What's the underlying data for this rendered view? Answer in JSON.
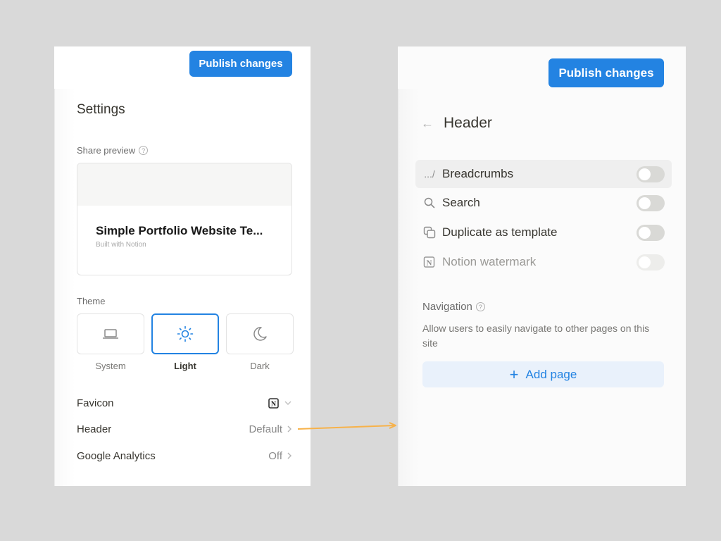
{
  "left_panel": {
    "publish_label": "Publish changes",
    "title": "Settings",
    "share_preview": {
      "label": "Share preview",
      "help_icon": "?",
      "card_title": "Simple Portfolio Website Te...",
      "card_subtitle": "Built with Notion"
    },
    "theme": {
      "label": "Theme",
      "options": [
        {
          "name": "System",
          "icon": "laptop-icon",
          "selected": false
        },
        {
          "name": "Light",
          "icon": "sun-icon",
          "selected": true
        },
        {
          "name": "Dark",
          "icon": "moon-icon",
          "selected": false
        }
      ]
    },
    "rows": [
      {
        "label": "Favicon",
        "value": "",
        "icon": "notion-logo-icon",
        "chevron": "chevron-down-icon"
      },
      {
        "label": "Header",
        "value": "Default",
        "chevron": "chevron-right-icon"
      },
      {
        "label": "Google Analytics",
        "value": "Off",
        "chevron": "chevron-right-icon"
      }
    ]
  },
  "right_panel": {
    "publish_label": "Publish changes",
    "back_icon": "←",
    "title": "Header",
    "toggles": [
      {
        "label": "Breadcrumbs",
        "icon_text": ".../",
        "enabled": false,
        "disabled": false,
        "hovered": true
      },
      {
        "label": "Search",
        "icon_text": "",
        "enabled": false,
        "disabled": false,
        "hovered": false
      },
      {
        "label": "Duplicate as template",
        "icon_text": "",
        "enabled": false,
        "disabled": false,
        "hovered": false
      },
      {
        "label": "Notion watermark",
        "icon_text": "N",
        "enabled": false,
        "disabled": true,
        "hovered": false
      }
    ],
    "navigation": {
      "label": "Navigation",
      "help_icon": "?",
      "description": "Allow users to easily navigate to other pages on this site",
      "add_page_label": "Add page",
      "add_icon": "+"
    }
  },
  "colors": {
    "accent": "#2383e2",
    "annotation_arrow": "#f7b24a",
    "background": "#d9d9d9"
  }
}
